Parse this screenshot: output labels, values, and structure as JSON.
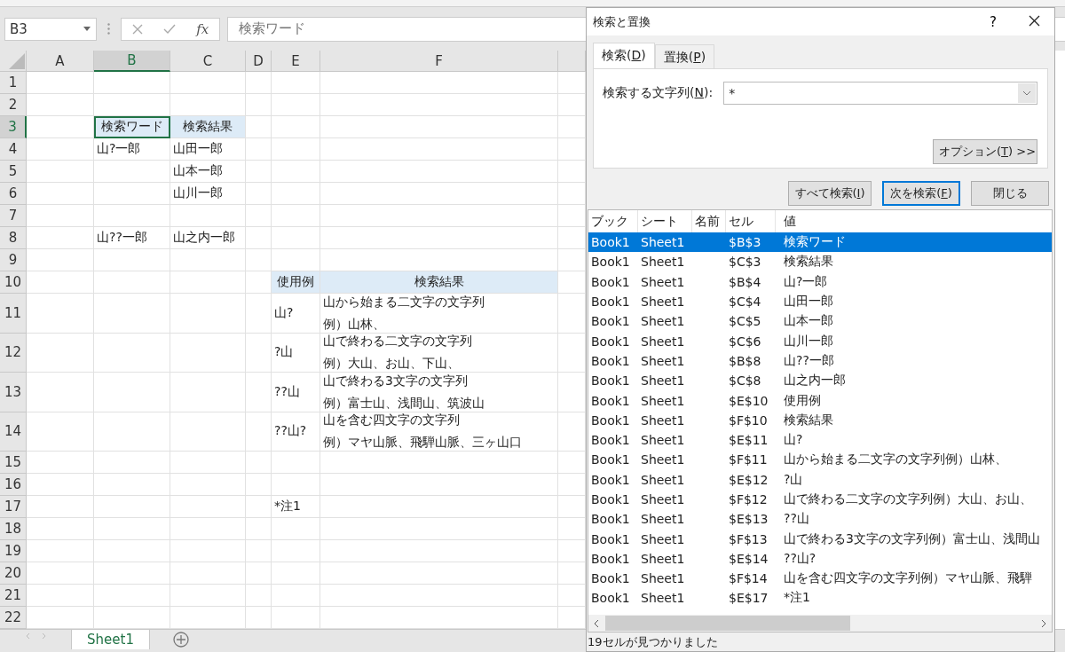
{
  "name_box": "B3",
  "formula_bar": {
    "function_label": "fx",
    "value": "検索ワード"
  },
  "sheet": {
    "columns": [
      {
        "label": "A",
        "selected": false
      },
      {
        "label": "B",
        "selected": true
      },
      {
        "label": "C",
        "selected": false
      },
      {
        "label": "D",
        "selected": false
      },
      {
        "label": "E",
        "selected": false
      },
      {
        "label": "F",
        "selected": false
      }
    ],
    "rows": [
      {
        "number": "1",
        "selected": false,
        "cells": [
          {},
          {},
          {},
          {},
          {},
          {}
        ]
      },
      {
        "number": "2",
        "selected": false,
        "cells": [
          {},
          {},
          {},
          {},
          {},
          {}
        ]
      },
      {
        "number": "3",
        "selected": true,
        "cells": [
          {},
          {
            "text": "検索ワード",
            "kind": "heading"
          },
          {
            "text": "検索結果",
            "kind": "heading"
          },
          {},
          {},
          {}
        ]
      },
      {
        "number": "4",
        "selected": false,
        "cells": [
          {},
          {
            "text": "山?一郎",
            "kind": "plain"
          },
          {
            "text": "山田一郎",
            "kind": "plain"
          },
          {},
          {},
          {}
        ]
      },
      {
        "number": "5",
        "selected": false,
        "cells": [
          {},
          {},
          {
            "text": "山本一郎",
            "kind": "plain"
          },
          {},
          {},
          {}
        ]
      },
      {
        "number": "6",
        "selected": false,
        "cells": [
          {},
          {},
          {
            "text": "山川一郎",
            "kind": "plain"
          },
          {},
          {},
          {}
        ]
      },
      {
        "number": "7",
        "selected": false,
        "cells": [
          {},
          {},
          {},
          {},
          {},
          {}
        ]
      },
      {
        "number": "8",
        "selected": false,
        "cells": [
          {},
          {
            "text": "山??一郎",
            "kind": "plain"
          },
          {
            "text": "山之内一郎",
            "kind": "plain"
          },
          {},
          {},
          {}
        ]
      },
      {
        "number": "9",
        "selected": false,
        "cells": [
          {},
          {},
          {},
          {},
          {},
          {}
        ]
      },
      {
        "number": "10",
        "selected": false,
        "cells": [
          {},
          {},
          {},
          {},
          {
            "text": "使用例",
            "kind": "heading"
          },
          {
            "text": "検索結果",
            "kind": "heading"
          }
        ]
      },
      {
        "number": "11",
        "selected": false,
        "cells": [
          {},
          {},
          {},
          {},
          {
            "text": "山?",
            "kind": "plain"
          },
          {
            "lines": [
              "山から始まる二文字の文字列",
              "例）山林、"
            ],
            "kind": "plain"
          }
        ]
      },
      {
        "number": "12",
        "selected": false,
        "cells": [
          {},
          {},
          {},
          {},
          {
            "text": "?山",
            "kind": "plain"
          },
          {
            "lines": [
              "山で終わる二文字の文字列",
              "例）大山、お山、下山、"
            ],
            "kind": "plain"
          }
        ]
      },
      {
        "number": "13",
        "selected": false,
        "cells": [
          {},
          {},
          {},
          {},
          {
            "text": "??山",
            "kind": "plain"
          },
          {
            "lines": [
              "山で終わる3文字の文字列",
              "例）富士山、浅間山、筑波山"
            ],
            "kind": "plain"
          }
        ]
      },
      {
        "number": "14",
        "selected": false,
        "cells": [
          {},
          {},
          {},
          {},
          {
            "text": "??山?",
            "kind": "plain"
          },
          {
            "lines": [
              "山を含む四文字の文字列",
              "例）マヤ山脈、飛騨山脈、三ヶ山口"
            ],
            "kind": "plain"
          }
        ]
      },
      {
        "number": "15",
        "selected": false,
        "cells": [
          {},
          {},
          {},
          {},
          {},
          {}
        ]
      },
      {
        "number": "16",
        "selected": false,
        "cells": [
          {},
          {},
          {},
          {},
          {},
          {}
        ]
      },
      {
        "number": "17",
        "selected": false,
        "cells": [
          {},
          {},
          {},
          {},
          {
            "text": "*注1",
            "kind": "plain"
          },
          {}
        ]
      },
      {
        "number": "18",
        "selected": false,
        "cells": [
          {},
          {},
          {},
          {},
          {},
          {}
        ]
      },
      {
        "number": "19",
        "selected": false,
        "cells": [
          {},
          {},
          {},
          {},
          {},
          {}
        ]
      },
      {
        "number": "20",
        "selected": false,
        "cells": [
          {},
          {},
          {},
          {},
          {},
          {}
        ]
      },
      {
        "number": "21",
        "selected": false,
        "cells": [
          {},
          {},
          {},
          {},
          {},
          {}
        ]
      },
      {
        "number": "22",
        "selected": false,
        "cells": [
          {},
          {},
          {},
          {},
          {},
          {}
        ]
      }
    ]
  },
  "sheet_tabs": [
    {
      "label": "Sheet1",
      "selected": true
    }
  ],
  "dialog": {
    "title": "検索と置換",
    "help": "?",
    "tabs": [
      {
        "label": "検索(",
        "key": "D",
        "end": ")",
        "selected": true
      },
      {
        "label": "置換(",
        "key": "P",
        "end": ")",
        "selected": false
      }
    ],
    "find_field": {
      "label": "検索する文字列(",
      "key": "N",
      "end": "):",
      "value": "*"
    },
    "options_button": {
      "label": "オプション(",
      "key": "T",
      "end": ") >>"
    },
    "buttons": [
      {
        "label": "すべて検索(",
        "key": "I",
        "end": ")",
        "default": false
      },
      {
        "label": "次を検索(",
        "key": "F",
        "end": ")",
        "default": true
      },
      {
        "label": "閉じる",
        "default": false
      }
    ],
    "results": {
      "columns": [
        "ブック",
        "シート",
        "名前",
        "セル",
        "値"
      ],
      "rows": [
        {
          "book": "Book1",
          "sheet": "Sheet1",
          "cell": "$B$3",
          "value": "検索ワード",
          "selected": true
        },
        {
          "book": "Book1",
          "sheet": "Sheet1",
          "cell": "$C$3",
          "value": "検索結果",
          "selected": false
        },
        {
          "book": "Book1",
          "sheet": "Sheet1",
          "cell": "$B$4",
          "value": "山?一郎",
          "selected": false
        },
        {
          "book": "Book1",
          "sheet": "Sheet1",
          "cell": "$C$4",
          "value": "山田一郎",
          "selected": false
        },
        {
          "book": "Book1",
          "sheet": "Sheet1",
          "cell": "$C$5",
          "value": "山本一郎",
          "selected": false
        },
        {
          "book": "Book1",
          "sheet": "Sheet1",
          "cell": "$C$6",
          "value": "山川一郎",
          "selected": false
        },
        {
          "book": "Book1",
          "sheet": "Sheet1",
          "cell": "$B$8",
          "value": "山??一郎",
          "selected": false
        },
        {
          "book": "Book1",
          "sheet": "Sheet1",
          "cell": "$C$8",
          "value": "山之内一郎",
          "selected": false
        },
        {
          "book": "Book1",
          "sheet": "Sheet1",
          "cell": "$E$10",
          "value": "使用例",
          "selected": false
        },
        {
          "book": "Book1",
          "sheet": "Sheet1",
          "cell": "$F$10",
          "value": "検索結果",
          "selected": false
        },
        {
          "book": "Book1",
          "sheet": "Sheet1",
          "cell": "$E$11",
          "value": "山?",
          "selected": false
        },
        {
          "book": "Book1",
          "sheet": "Sheet1",
          "cell": "$F$11",
          "value": "山から始まる二文字の文字列例）山林、",
          "selected": false
        },
        {
          "book": "Book1",
          "sheet": "Sheet1",
          "cell": "$E$12",
          "value": "?山",
          "selected": false
        },
        {
          "book": "Book1",
          "sheet": "Sheet1",
          "cell": "$F$12",
          "value": "山で終わる二文字の文字列例）大山、お山、",
          "selected": false
        },
        {
          "book": "Book1",
          "sheet": "Sheet1",
          "cell": "$E$13",
          "value": "??山",
          "selected": false
        },
        {
          "book": "Book1",
          "sheet": "Sheet1",
          "cell": "$F$13",
          "value": "山で終わる3文字の文字列例）富士山、浅間山",
          "selected": false
        },
        {
          "book": "Book1",
          "sheet": "Sheet1",
          "cell": "$E$14",
          "value": "??山?",
          "selected": false
        },
        {
          "book": "Book1",
          "sheet": "Sheet1",
          "cell": "$F$14",
          "value": "山を含む四文字の文字列例）マヤ山脈、飛騨",
          "selected": false
        },
        {
          "book": "Book1",
          "sheet": "Sheet1",
          "cell": "$E$17",
          "value": "*注1",
          "selected": false
        }
      ]
    },
    "status": "19セルが見つかりました"
  }
}
